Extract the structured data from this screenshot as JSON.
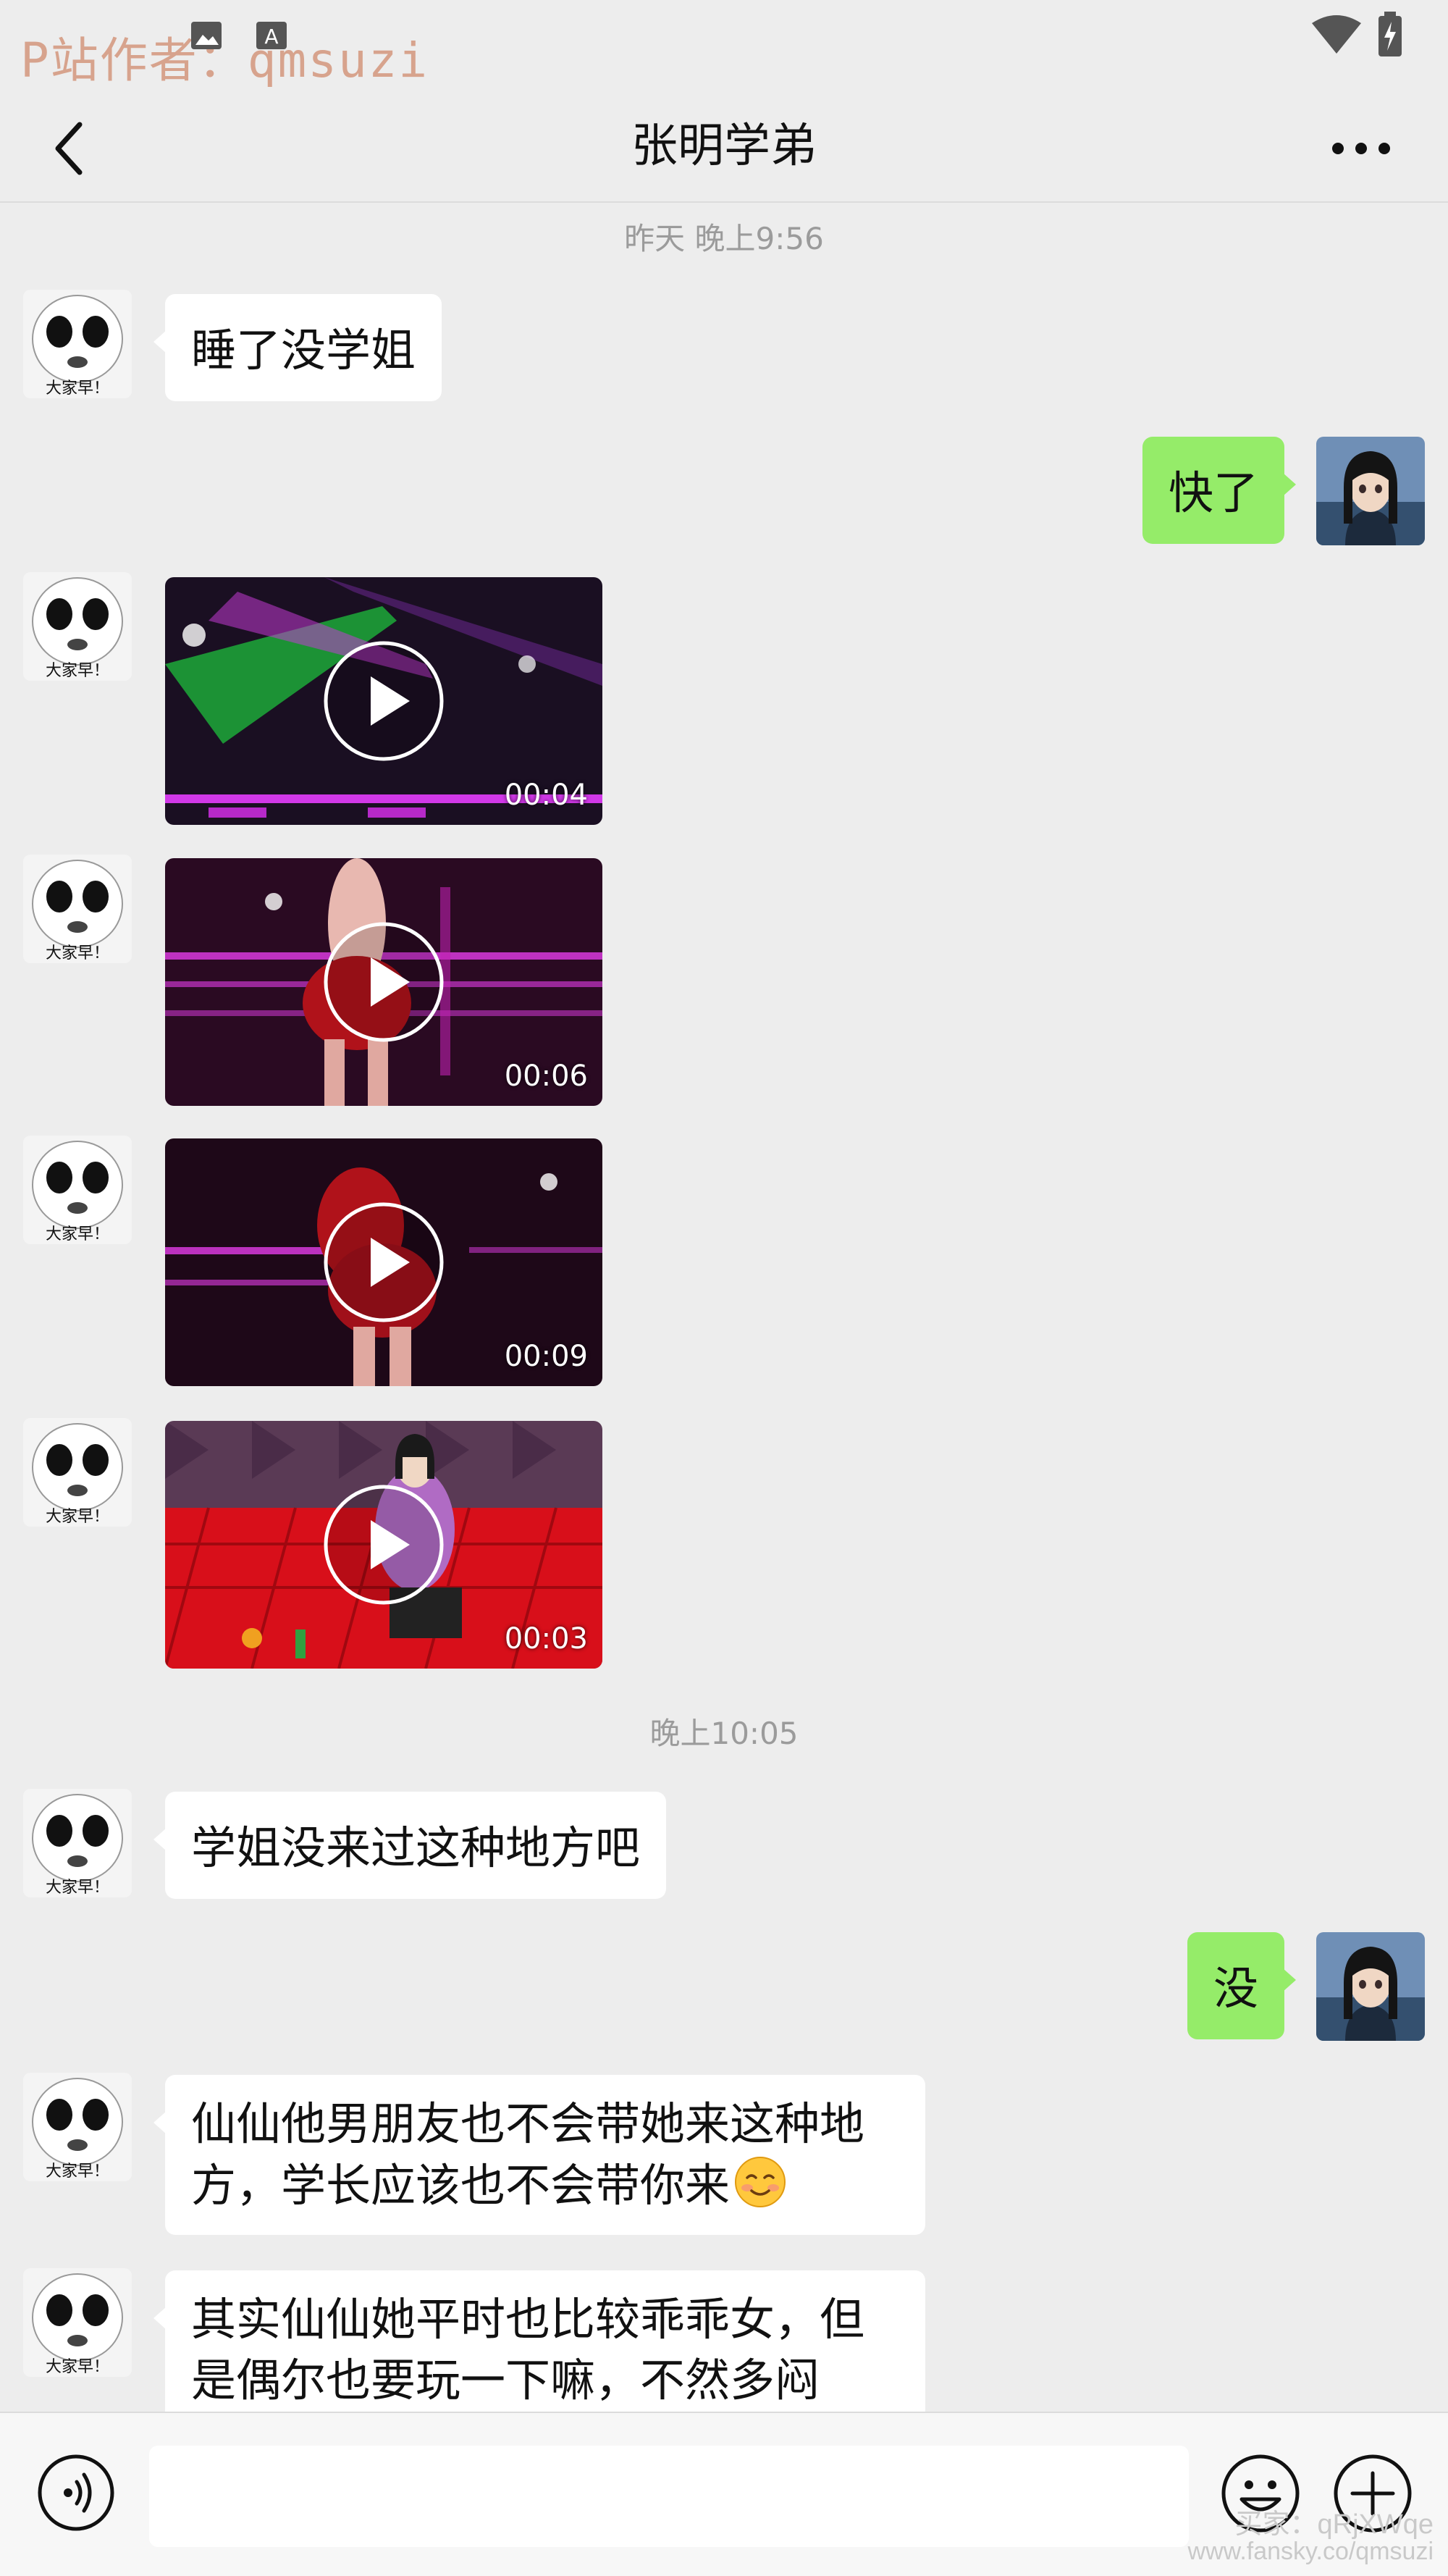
{
  "statusbar": {
    "watermark": "P站作者：qmsuzi",
    "icons": [
      "image-icon",
      "text-a-icon",
      "wifi-icon",
      "battery-charging-icon"
    ]
  },
  "navbar": {
    "back_icon": "chevron-left-icon",
    "title": "张明学弟",
    "more_icon": "more-dots-icon"
  },
  "timestamps": [
    "昨天 晚上9:56",
    "晚上10:05"
  ],
  "messages": [
    {
      "side": "left",
      "type": "text",
      "text": "睡了没学姐"
    },
    {
      "side": "right",
      "type": "text",
      "text": "快了"
    },
    {
      "side": "left",
      "type": "video",
      "duration": "00:04"
    },
    {
      "side": "left",
      "type": "video",
      "duration": "00:06"
    },
    {
      "side": "left",
      "type": "video",
      "duration": "00:09"
    },
    {
      "side": "left",
      "type": "video",
      "duration": "00:03"
    },
    {
      "side": "left",
      "type": "text",
      "text": "学姐没来过这种地方吧"
    },
    {
      "side": "right",
      "type": "text",
      "text": "没"
    },
    {
      "side": "left",
      "type": "text",
      "line1": "仙仙他男朋友也不会带她来这种地",
      "line2": "方，学长应该也不会带你来",
      "emoji": "smiling-face-emoji"
    },
    {
      "side": "left",
      "type": "text",
      "line1": "其实仙仙她平时也比较乖乖女，但",
      "line2": "是偶尔也要玩一下嘛，不然多闷"
    }
  ],
  "avatars": {
    "left_caption": "大家早！",
    "left_icon": "meme-face-avatar",
    "right_icon": "anime-girl-avatar"
  },
  "inputbar": {
    "voice_icon": "voice-icon",
    "emoji_icon": "emoji-icon",
    "plus_icon": "plus-icon"
  },
  "overlay_watermark": {
    "line1": "买家：qRjXWqe",
    "line2": "www.fansky.co/qmsuzi"
  },
  "colors": {
    "background": "#ededed",
    "bubble_self": "#95ec69",
    "bubble_other": "#ffffff",
    "timestamp": "#9b9b9b"
  }
}
